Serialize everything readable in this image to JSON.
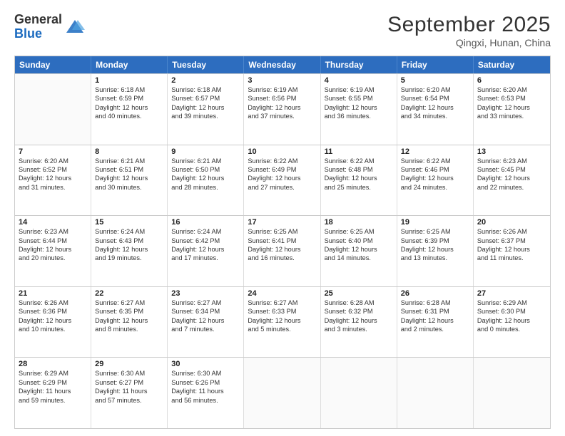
{
  "header": {
    "logo_general": "General",
    "logo_blue": "Blue",
    "month_title": "September 2025",
    "subtitle": "Qingxi, Hunan, China"
  },
  "days_of_week": [
    "Sunday",
    "Monday",
    "Tuesday",
    "Wednesday",
    "Thursday",
    "Friday",
    "Saturday"
  ],
  "weeks": [
    [
      {
        "day": "",
        "lines": []
      },
      {
        "day": "1",
        "lines": [
          "Sunrise: 6:18 AM",
          "Sunset: 6:59 PM",
          "Daylight: 12 hours",
          "and 40 minutes."
        ]
      },
      {
        "day": "2",
        "lines": [
          "Sunrise: 6:18 AM",
          "Sunset: 6:57 PM",
          "Daylight: 12 hours",
          "and 39 minutes."
        ]
      },
      {
        "day": "3",
        "lines": [
          "Sunrise: 6:19 AM",
          "Sunset: 6:56 PM",
          "Daylight: 12 hours",
          "and 37 minutes."
        ]
      },
      {
        "day": "4",
        "lines": [
          "Sunrise: 6:19 AM",
          "Sunset: 6:55 PM",
          "Daylight: 12 hours",
          "and 36 minutes."
        ]
      },
      {
        "day": "5",
        "lines": [
          "Sunrise: 6:20 AM",
          "Sunset: 6:54 PM",
          "Daylight: 12 hours",
          "and 34 minutes."
        ]
      },
      {
        "day": "6",
        "lines": [
          "Sunrise: 6:20 AM",
          "Sunset: 6:53 PM",
          "Daylight: 12 hours",
          "and 33 minutes."
        ]
      }
    ],
    [
      {
        "day": "7",
        "lines": [
          "Sunrise: 6:20 AM",
          "Sunset: 6:52 PM",
          "Daylight: 12 hours",
          "and 31 minutes."
        ]
      },
      {
        "day": "8",
        "lines": [
          "Sunrise: 6:21 AM",
          "Sunset: 6:51 PM",
          "Daylight: 12 hours",
          "and 30 minutes."
        ]
      },
      {
        "day": "9",
        "lines": [
          "Sunrise: 6:21 AM",
          "Sunset: 6:50 PM",
          "Daylight: 12 hours",
          "and 28 minutes."
        ]
      },
      {
        "day": "10",
        "lines": [
          "Sunrise: 6:22 AM",
          "Sunset: 6:49 PM",
          "Daylight: 12 hours",
          "and 27 minutes."
        ]
      },
      {
        "day": "11",
        "lines": [
          "Sunrise: 6:22 AM",
          "Sunset: 6:48 PM",
          "Daylight: 12 hours",
          "and 25 minutes."
        ]
      },
      {
        "day": "12",
        "lines": [
          "Sunrise: 6:22 AM",
          "Sunset: 6:46 PM",
          "Daylight: 12 hours",
          "and 24 minutes."
        ]
      },
      {
        "day": "13",
        "lines": [
          "Sunrise: 6:23 AM",
          "Sunset: 6:45 PM",
          "Daylight: 12 hours",
          "and 22 minutes."
        ]
      }
    ],
    [
      {
        "day": "14",
        "lines": [
          "Sunrise: 6:23 AM",
          "Sunset: 6:44 PM",
          "Daylight: 12 hours",
          "and 20 minutes."
        ]
      },
      {
        "day": "15",
        "lines": [
          "Sunrise: 6:24 AM",
          "Sunset: 6:43 PM",
          "Daylight: 12 hours",
          "and 19 minutes."
        ]
      },
      {
        "day": "16",
        "lines": [
          "Sunrise: 6:24 AM",
          "Sunset: 6:42 PM",
          "Daylight: 12 hours",
          "and 17 minutes."
        ]
      },
      {
        "day": "17",
        "lines": [
          "Sunrise: 6:25 AM",
          "Sunset: 6:41 PM",
          "Daylight: 12 hours",
          "and 16 minutes."
        ]
      },
      {
        "day": "18",
        "lines": [
          "Sunrise: 6:25 AM",
          "Sunset: 6:40 PM",
          "Daylight: 12 hours",
          "and 14 minutes."
        ]
      },
      {
        "day": "19",
        "lines": [
          "Sunrise: 6:25 AM",
          "Sunset: 6:39 PM",
          "Daylight: 12 hours",
          "and 13 minutes."
        ]
      },
      {
        "day": "20",
        "lines": [
          "Sunrise: 6:26 AM",
          "Sunset: 6:37 PM",
          "Daylight: 12 hours",
          "and 11 minutes."
        ]
      }
    ],
    [
      {
        "day": "21",
        "lines": [
          "Sunrise: 6:26 AM",
          "Sunset: 6:36 PM",
          "Daylight: 12 hours",
          "and 10 minutes."
        ]
      },
      {
        "day": "22",
        "lines": [
          "Sunrise: 6:27 AM",
          "Sunset: 6:35 PM",
          "Daylight: 12 hours",
          "and 8 minutes."
        ]
      },
      {
        "day": "23",
        "lines": [
          "Sunrise: 6:27 AM",
          "Sunset: 6:34 PM",
          "Daylight: 12 hours",
          "and 7 minutes."
        ]
      },
      {
        "day": "24",
        "lines": [
          "Sunrise: 6:27 AM",
          "Sunset: 6:33 PM",
          "Daylight: 12 hours",
          "and 5 minutes."
        ]
      },
      {
        "day": "25",
        "lines": [
          "Sunrise: 6:28 AM",
          "Sunset: 6:32 PM",
          "Daylight: 12 hours",
          "and 3 minutes."
        ]
      },
      {
        "day": "26",
        "lines": [
          "Sunrise: 6:28 AM",
          "Sunset: 6:31 PM",
          "Daylight: 12 hours",
          "and 2 minutes."
        ]
      },
      {
        "day": "27",
        "lines": [
          "Sunrise: 6:29 AM",
          "Sunset: 6:30 PM",
          "Daylight: 12 hours",
          "and 0 minutes."
        ]
      }
    ],
    [
      {
        "day": "28",
        "lines": [
          "Sunrise: 6:29 AM",
          "Sunset: 6:29 PM",
          "Daylight: 11 hours",
          "and 59 minutes."
        ]
      },
      {
        "day": "29",
        "lines": [
          "Sunrise: 6:30 AM",
          "Sunset: 6:27 PM",
          "Daylight: 11 hours",
          "and 57 minutes."
        ]
      },
      {
        "day": "30",
        "lines": [
          "Sunrise: 6:30 AM",
          "Sunset: 6:26 PM",
          "Daylight: 11 hours",
          "and 56 minutes."
        ]
      },
      {
        "day": "",
        "lines": []
      },
      {
        "day": "",
        "lines": []
      },
      {
        "day": "",
        "lines": []
      },
      {
        "day": "",
        "lines": []
      }
    ]
  ]
}
